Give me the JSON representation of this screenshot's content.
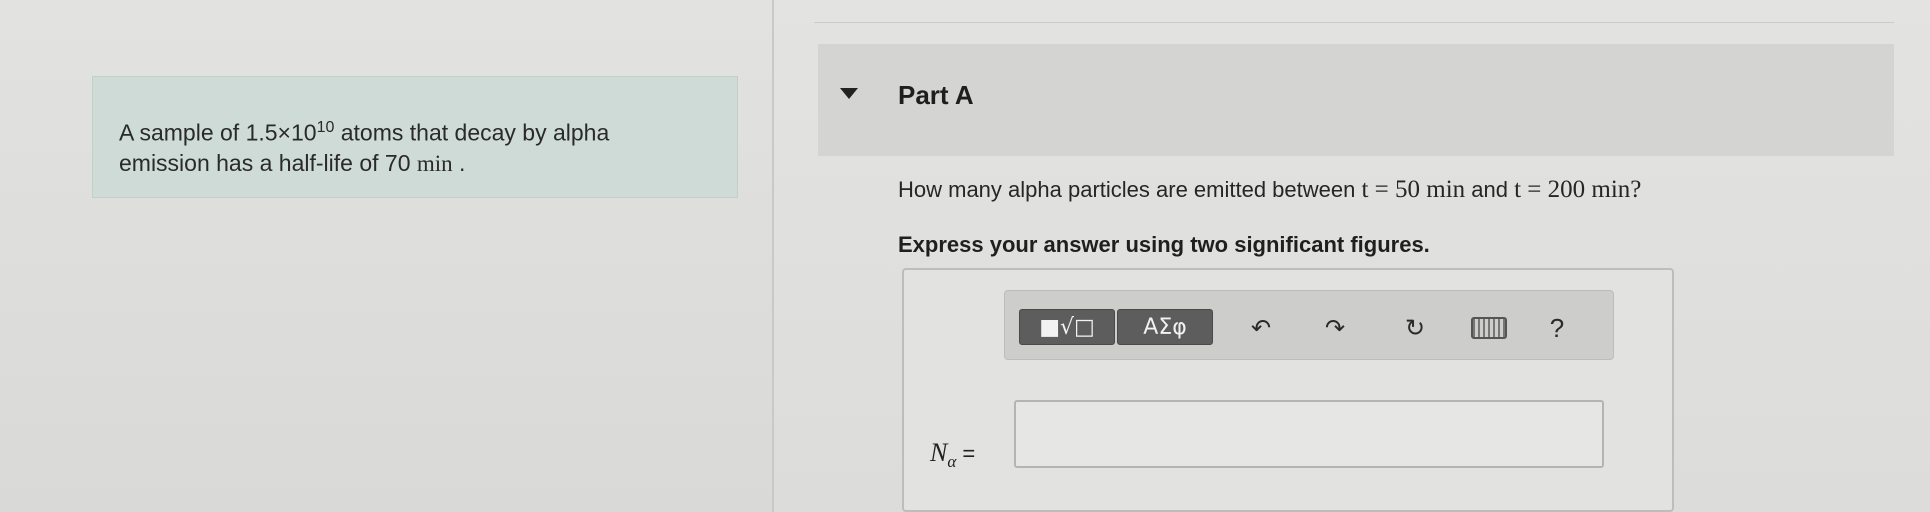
{
  "problem": {
    "prefix": "A sample of 1.5×10",
    "exponent": "10",
    "middle": " atoms that decay by alpha",
    "line2": "emission has a half-life of 70 ",
    "unit": "min",
    "period": " ."
  },
  "part": {
    "title": "Part A",
    "question_prefix": "How many alpha particles are emitted between ",
    "t1": "t = 50 min",
    "and_word": " and ",
    "t2": "t = 200 min?",
    "instruction": "Express your answer using two significant figures."
  },
  "toolbar": {
    "template_button": "■√□",
    "symbols_button": "ΑΣφ",
    "undo": "↶",
    "redo": "↷",
    "reset": "↻",
    "help": "?"
  },
  "answer": {
    "variable": "N",
    "subscript": "α",
    "equals": " =",
    "value": "",
    "placeholder": ""
  }
}
